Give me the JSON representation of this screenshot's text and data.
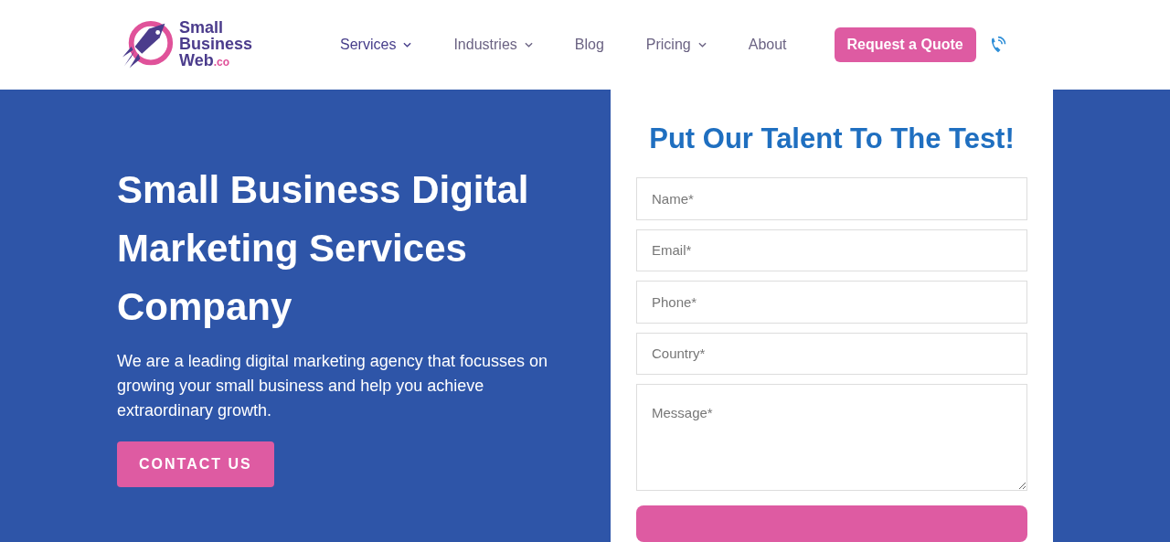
{
  "logo": {
    "line_1": "Small",
    "line_2": "Business",
    "line_3": "Web",
    "suffix": ".co"
  },
  "nav": [
    {
      "label": "Services",
      "dropdown": true,
      "selected": true
    },
    {
      "label": "Industries",
      "dropdown": true,
      "selected": false
    },
    {
      "label": "Blog",
      "dropdown": false,
      "selected": false
    },
    {
      "label": "Pricing",
      "dropdown": true,
      "selected": false
    },
    {
      "label": "About",
      "dropdown": false,
      "selected": false
    }
  ],
  "cta": "Request a Quote",
  "hero": {
    "title": "Small Business Digital Marketing Services Company",
    "text": "We are a leading digital marketing agency that focusses on growing your small business and help you achieve extraordinary growth.",
    "button": "CONTACT US"
  },
  "form": {
    "title": "Put Our Talent To The Test!",
    "fields": [
      {
        "kind": "input",
        "placeholder": "Name*"
      },
      {
        "kind": "input",
        "placeholder": "Email*"
      },
      {
        "kind": "input",
        "placeholder": "Phone*"
      },
      {
        "kind": "input",
        "placeholder": "Country*"
      },
      {
        "kind": "textarea",
        "placeholder": "Message*"
      }
    ]
  }
}
